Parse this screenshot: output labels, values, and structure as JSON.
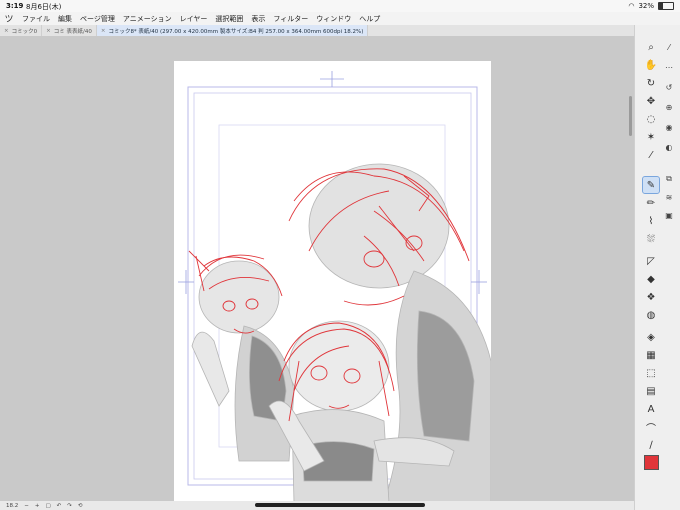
{
  "status": {
    "time": "3:19",
    "date": "8月6日(木)",
    "battery": "32%",
    "battery_level": 0.32
  },
  "menu": {
    "logo_icon": "clip-studio-logo-icon",
    "items": [
      "ファイル",
      "編集",
      "ページ管理",
      "アニメーション",
      "レイヤー",
      "選択範囲",
      "表示",
      "フィルター",
      "ウィンドウ",
      "ヘルプ"
    ]
  },
  "tabs": [
    {
      "label": "コミック0"
    },
    {
      "label": "コミ 表表紙/40"
    },
    {
      "label": "コミック8* 表紙/40 (297.00 x 420.00mm 製本サイズ:B4 判 257.00 x 364.00mm 600dpi 18.2%)"
    }
  ],
  "bottom": {
    "zoom": "18.2",
    "minus": "−",
    "plus": "+"
  },
  "colors": {
    "main_color": "#e0353a",
    "accent": "#7aa6dd"
  }
}
